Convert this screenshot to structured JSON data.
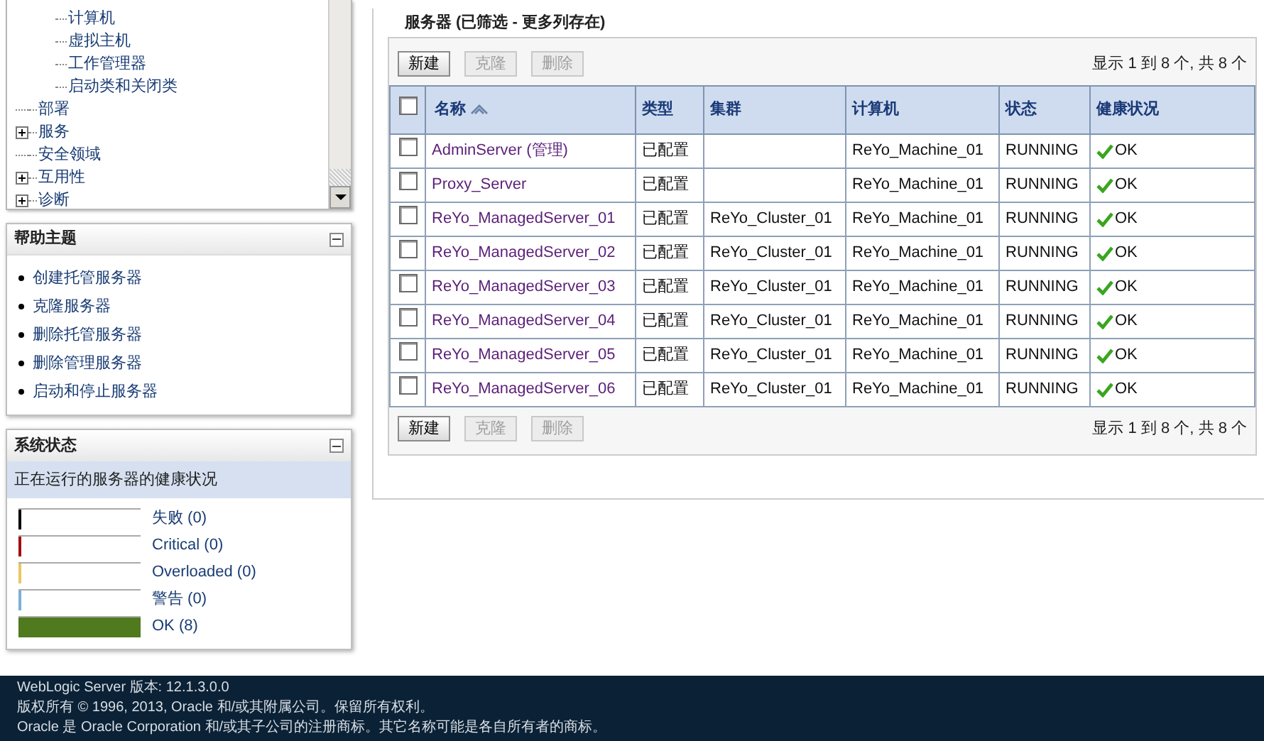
{
  "tree": {
    "sub_items": [
      {
        "label": "计算机"
      },
      {
        "label": "虚拟主机"
      },
      {
        "label": "工作管理器"
      },
      {
        "label": "启动类和关闭类"
      }
    ],
    "items": [
      {
        "label": "部署",
        "kind": "leaf"
      },
      {
        "label": "服务",
        "kind": "collapsed"
      },
      {
        "label": "安全领域",
        "kind": "leaf"
      },
      {
        "label": "互用性",
        "kind": "collapsed"
      },
      {
        "label": "诊断",
        "kind": "collapsed"
      }
    ]
  },
  "help": {
    "title": "帮助主题",
    "links": [
      "创建托管服务器",
      "克隆服务器",
      "删除托管服务器",
      "删除管理服务器",
      "启动和停止服务器"
    ]
  },
  "system_status": {
    "title": "系统状态",
    "subtitle": "正在运行的服务器的健康状况",
    "bars": [
      {
        "label": "失败 (0)",
        "level": 0,
        "color": "#000000"
      },
      {
        "label": "Critical (0)",
        "level": 0,
        "color": "#a01010"
      },
      {
        "label": "Overloaded (0)",
        "level": 0,
        "color": "#e8c860"
      },
      {
        "label": "警告 (0)",
        "level": 0,
        "color": "#7ab0d8"
      },
      {
        "label": "OK (8)",
        "level": 1,
        "color": "#4f7a1e"
      }
    ]
  },
  "servers": {
    "title": "服务器 (已筛选 - 更多列存在)",
    "buttons": [
      {
        "label": "新建",
        "disabled": false
      },
      {
        "label": "克隆",
        "disabled": true
      },
      {
        "label": "删除",
        "disabled": true
      }
    ],
    "count": "显示 1 到 8 个, 共 8 个",
    "select_all_checked": false,
    "columns": [
      "名称",
      "类型",
      "集群",
      "计算机",
      "状态",
      "健康状况"
    ],
    "rows": [
      {
        "name": "AdminServer (管理)",
        "type": "已配置",
        "cluster": "",
        "machine": "ReYo_Machine_01",
        "state": "RUNNING",
        "health": "OK",
        "checked": false
      },
      {
        "name": "Proxy_Server",
        "type": "已配置",
        "cluster": "",
        "machine": "ReYo_Machine_01",
        "state": "RUNNING",
        "health": "OK",
        "checked": false
      },
      {
        "name": "ReYo_ManagedServer_01",
        "type": "已配置",
        "cluster": "ReYo_Cluster_01",
        "machine": "ReYo_Machine_01",
        "state": "RUNNING",
        "health": "OK",
        "checked": false
      },
      {
        "name": "ReYo_ManagedServer_02",
        "type": "已配置",
        "cluster": "ReYo_Cluster_01",
        "machine": "ReYo_Machine_01",
        "state": "RUNNING",
        "health": "OK",
        "checked": false
      },
      {
        "name": "ReYo_ManagedServer_03",
        "type": "已配置",
        "cluster": "ReYo_Cluster_01",
        "machine": "ReYo_Machine_01",
        "state": "RUNNING",
        "health": "OK",
        "checked": false
      },
      {
        "name": "ReYo_ManagedServer_04",
        "type": "已配置",
        "cluster": "ReYo_Cluster_01",
        "machine": "ReYo_Machine_01",
        "state": "RUNNING",
        "health": "OK",
        "checked": false
      },
      {
        "name": "ReYo_ManagedServer_05",
        "type": "已配置",
        "cluster": "ReYo_Cluster_01",
        "machine": "ReYo_Machine_01",
        "state": "RUNNING",
        "health": "OK",
        "checked": false
      },
      {
        "name": "ReYo_ManagedServer_06",
        "type": "已配置",
        "cluster": "ReYo_Cluster_01",
        "machine": "ReYo_Machine_01",
        "state": "RUNNING",
        "health": "OK",
        "checked": false
      }
    ],
    "bottom_buttons": [
      {
        "label": "新建",
        "disabled": false
      },
      {
        "label": "克隆",
        "disabled": true
      },
      {
        "label": "删除",
        "disabled": true
      }
    ],
    "bottom_count": "显示 1 到 8 个, 共 8 个"
  },
  "footer": [
    "WebLogic Server 版本: 12.1.3.0.0",
    "版权所有 © 1996, 2013, Oracle 和/或其附属公司。保留所有权利。",
    "Oracle 是 Oracle Corporation 和/或其子公司的注册商标。其它名称可能是各自所有者的商标。"
  ]
}
